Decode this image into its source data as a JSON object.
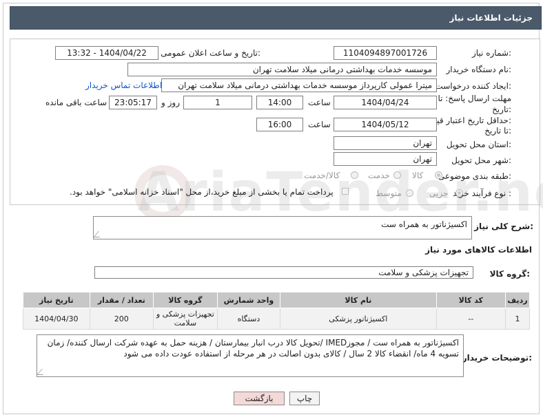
{
  "panel": {
    "title": "جزئیات اطلاعات نیاز"
  },
  "form": {
    "need_number": {
      "label": "شماره نیاز:",
      "value": "1104094897001726"
    },
    "announce_datetime": {
      "label": "تاریخ و ساعت اعلان عمومی:",
      "value": "1404/04/22 - 13:32"
    },
    "buyer_org": {
      "label": "نام دستگاه خریدار:",
      "value": "موسسه خدمات بهداشتی درمانی میلاد سلامت تهران"
    },
    "requester": {
      "label": "ایجاد کننده درخواست:",
      "value": "میترا عمولی کارپرداز موسسه خدمات بهداشتی درمانی میلاد سلامت تهران",
      "contact_link": "اطلاعات تماس خریدار"
    },
    "reply_deadline": {
      "label_line1": "مهلت ارسال پاسخ: تا",
      "label_line2": "تاریخ:",
      "date": "1404/04/24",
      "time_label": "ساعت",
      "time": "14:00",
      "days": "1",
      "days_label": "روز و",
      "remaining": "23:05:17",
      "remaining_label": "ساعت باقی مانده"
    },
    "price_validity": {
      "label_line1": "حداقل تاریخ اعتبار قیمت:",
      "label_line2": "تا تاریخ:",
      "date": "1404/05/12",
      "time_label": "ساعت",
      "time": "16:00"
    },
    "delivery_province": {
      "label": "استان محل تحویل:",
      "value": "تهران"
    },
    "delivery_city": {
      "label": "شهر محل تحویل:",
      "value": "تهران"
    },
    "category": {
      "label": "طبقه بندی موضوعی:",
      "options": [
        "کالا",
        "خدمت",
        "کالا/خدمت"
      ],
      "selected": "کالا"
    },
    "purchase_type": {
      "label": "نوع فرآیند خرید :",
      "options": [
        "جزیی",
        "متوسط"
      ],
      "selected": "جزیی",
      "treasury_note": "پرداخت تمام یا بخشی از مبلغ خرید،از محل \"اسناد خزانه اسلامی\" خواهد بود."
    }
  },
  "description": {
    "label": "شرح کلی نیاز:",
    "value": "اکسیژناتور به همراه ست"
  },
  "goods_section": {
    "title": "اطلاعات کالاهای مورد نیاز",
    "group_label": "گروه کالا:",
    "group_value": "تجهیزات پزشکی و سلامت"
  },
  "table": {
    "headers": [
      "ردیف",
      "کد کالا",
      "نام کالا",
      "واحد شمارش",
      "گروه کالا",
      "تعداد / مقدار",
      "تاریخ نیاز"
    ],
    "rows": [
      [
        "1",
        "--",
        "اکسیژناتور پزشکی",
        "دستگاه",
        "تجهیزات پزشکی و سلامت",
        "200",
        "1404/04/30"
      ]
    ]
  },
  "buyer_notes": {
    "label": "توضیحات خریدار:",
    "value": "اکسیژناتور به همراه ست   / مجوزIMED /تحویل کالا درب انبار بیمارستان / هزینه حمل به عهده شرکت ارسال کننده/ زمان تسویه 4 ماه/ انقضاء کالا 2 سال / کالای بدون اصالت در هر مرحله از استفاده عودت داده می شود"
  },
  "buttons": {
    "print": "چاپ",
    "back": "بازگشت"
  },
  "watermark": "AriaTender.neT",
  "colors": {
    "header_bg": "#4a5a6a",
    "link": "#1155cc",
    "back_btn": "#f4d9d9",
    "table_header": "#c7c7c7"
  }
}
